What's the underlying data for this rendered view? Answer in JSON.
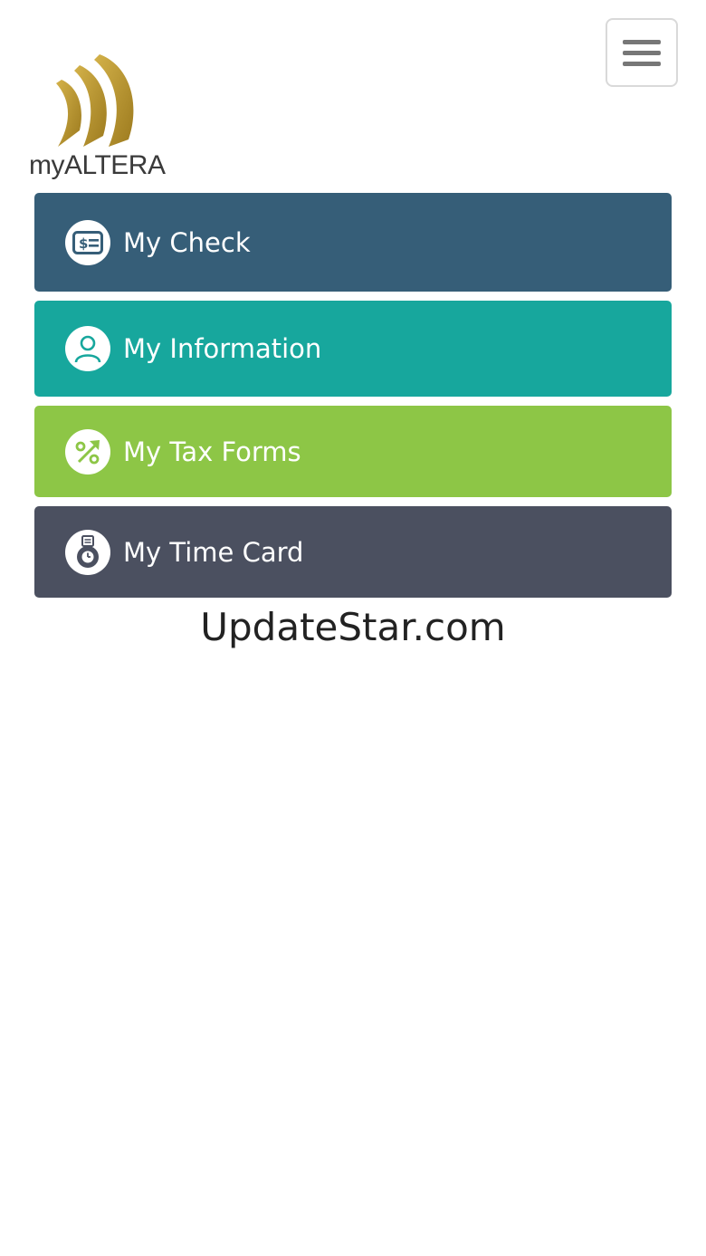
{
  "header": {
    "brand_name": "myALTERA",
    "menu_icon": "hamburger-menu-icon"
  },
  "colors": {
    "my_check": "#365e78",
    "my_information": "#17a79d",
    "my_tax_forms": "#8dc646",
    "my_time_card": "#4b5060",
    "logo_gold": "#b8952f"
  },
  "menu": {
    "items": [
      {
        "label": "My Check",
        "icon": "check-dollar-icon"
      },
      {
        "label": "My Information",
        "icon": "person-icon"
      },
      {
        "label": "My Tax Forms",
        "icon": "percent-arrow-icon"
      },
      {
        "label": "My Time Card",
        "icon": "time-card-clock-icon"
      }
    ]
  },
  "footer": {
    "text": "UpdateStar.com"
  }
}
